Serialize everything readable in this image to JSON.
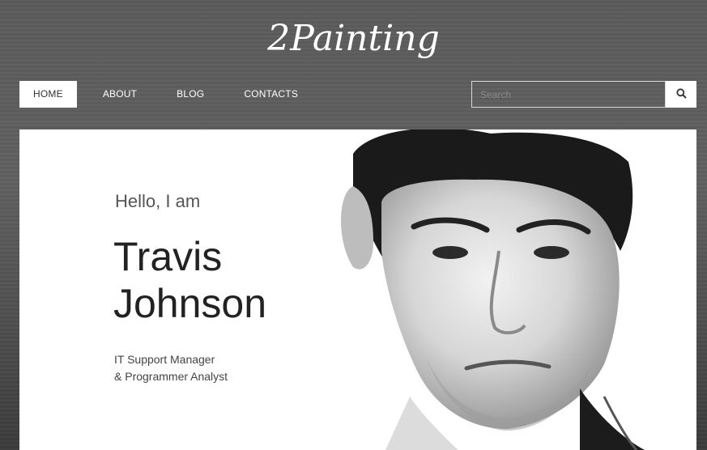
{
  "brand": {
    "logo_text": "2Painting"
  },
  "nav": {
    "items": [
      {
        "label": "HOME",
        "active": true
      },
      {
        "label": "ABOUT",
        "active": false
      },
      {
        "label": "BLOG",
        "active": false
      },
      {
        "label": "CONTACTS",
        "active": false
      }
    ]
  },
  "search": {
    "placeholder": "Search",
    "value": "",
    "icon": "search-icon"
  },
  "hero": {
    "greeting": "Hello, I am",
    "name_line1": "Travis",
    "name_line2": "Johnson",
    "role_line1": "IT Support Manager",
    "role_line2": "& Programmer Analyst"
  },
  "colors": {
    "header_bg": "#5e5e5e",
    "nav_active_bg": "#ffffff",
    "hero_bg": "#ffffff",
    "text_dark": "#222222"
  }
}
